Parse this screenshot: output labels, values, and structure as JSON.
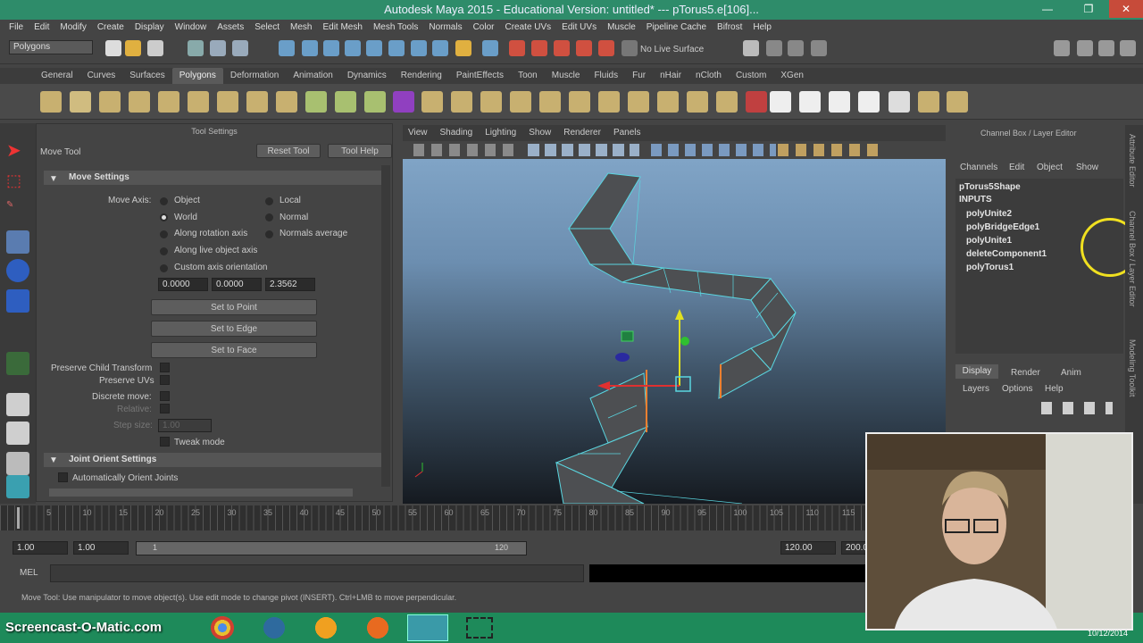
{
  "window": {
    "title": "Autodesk Maya 2015 - Educational Version: untitled*   ---   pTorus5.e[106]...",
    "min_glyph": "—",
    "max_glyph": "❐",
    "close_glyph": "✕"
  },
  "menubar": {
    "items": [
      "File",
      "Edit",
      "Modify",
      "Create",
      "Display",
      "Window",
      "Assets",
      "Select",
      "Mesh",
      "Edit Mesh",
      "Mesh Tools",
      "Normals",
      "Color",
      "Create UVs",
      "Edit UVs",
      "Muscle",
      "Pipeline Cache",
      "Bifrost",
      "Help"
    ]
  },
  "status_line": {
    "mode": "Polygons",
    "live_surface": "No Live Surface"
  },
  "shelf": {
    "tabs": [
      "General",
      "Curves",
      "Surfaces",
      "Polygons",
      "Deformation",
      "Animation",
      "Dynamics",
      "Rendering",
      "PaintEffects",
      "Toon",
      "Muscle",
      "Fluids",
      "Fur",
      "nHair",
      "nCloth",
      "Custom",
      "XGen"
    ],
    "active_tab": "Polygons"
  },
  "tool_settings": {
    "header": "Tool Settings",
    "tool_name": "Move Tool",
    "reset_tool": "Reset Tool",
    "tool_help": "Tool Help",
    "move_settings": {
      "title": "Move Settings",
      "move_axis_label": "Move Axis:",
      "options": [
        "Object",
        "Local",
        "World",
        "Normal",
        "Along rotation axis",
        "Normals average",
        "Along live object axis",
        "Custom axis orientation"
      ],
      "selected": "World",
      "values": [
        "0.0000",
        "0.0000",
        "2.3562"
      ],
      "set_to_point": "Set to Point",
      "set_to_edge": "Set to Edge",
      "set_to_face": "Set to Face",
      "preserve_child_transform": "Preserve Child Transform",
      "preserve_uvs": "Preserve UVs",
      "discrete_move": "Discrete move:",
      "relative": "Relative:",
      "step_size": "Step size:",
      "step_value": "1.00",
      "tweak_mode": "Tweak mode"
    },
    "joint_orient_settings": {
      "title": "Joint Orient Settings",
      "auto_orient": "Automatically Orient Joints"
    }
  },
  "viewport": {
    "menu": [
      "View",
      "Shading",
      "Lighting",
      "Show",
      "Renderer",
      "Panels"
    ]
  },
  "channel_box": {
    "header": "Channel Box / Layer Editor",
    "menu": [
      "Channels",
      "Edit",
      "Object",
      "Show"
    ],
    "shape": "pTorus5Shape",
    "inputs_label": "INPUTS",
    "inputs": [
      "polyUnite2",
      "polyBridgeEdge1",
      "polyUnite1",
      "deleteComponent1",
      "polyTorus1"
    ],
    "layer_tabs": [
      "Display",
      "Render",
      "Anim"
    ],
    "active_layer_tab": "Display",
    "layer_menu": [
      "Layers",
      "Options",
      "Help"
    ]
  },
  "right_strip": {
    "tabs": [
      "Attribute Editor",
      "Channel Box / Layer Editor",
      "Modeling Toolkit"
    ]
  },
  "time_slider": {
    "ticks": [
      "5",
      "10",
      "15",
      "20",
      "25",
      "30",
      "35",
      "40",
      "45",
      "50",
      "55",
      "60",
      "65",
      "70",
      "75",
      "80",
      "85",
      "90",
      "95",
      "100",
      "105",
      "110",
      "115"
    ]
  },
  "range_slider": {
    "start": "1.00",
    "current": "1.00",
    "range_start": "1",
    "range_end": "120",
    "end": "120.00",
    "max": "200.00"
  },
  "command_line": {
    "label": "MEL"
  },
  "help_line": {
    "text": "Move Tool: Use manipulator to move object(s). Use edit mode to change pivot (INSERT). Ctrl+LMB to move perpendicular."
  },
  "taskbar": {
    "clock": "10/12/2014"
  },
  "watermark": "Screencast-O-Matic.com",
  "colors": {
    "title_bar": "#2e8c6a",
    "panel": "#444444",
    "selection_cyan": "#5ad6e0",
    "taskbar": "#1e8a5a"
  }
}
